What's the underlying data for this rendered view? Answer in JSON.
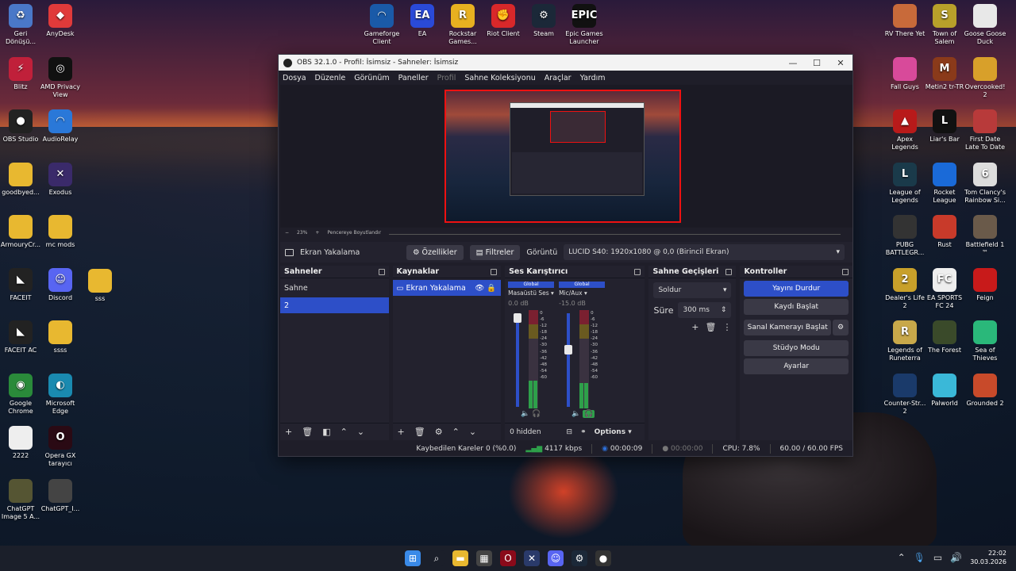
{
  "desktop": {
    "left_col1": [
      {
        "label": "Geri Dönüşü...",
        "icon": "recycle-bin-icon",
        "color": "#4a78c8",
        "glyph": "♻"
      },
      {
        "label": "Blitz",
        "icon": "blitz-icon",
        "color": "#c0203a",
        "glyph": "⚡"
      },
      {
        "label": "OBS Studio",
        "icon": "obs-icon",
        "color": "#222",
        "glyph": "●"
      },
      {
        "label": "goodbyed...",
        "icon": "folder-icon",
        "color": "#e8b830",
        "glyph": ""
      },
      {
        "label": "ArmouryCr...",
        "icon": "folder-icon",
        "color": "#e8b830",
        "glyph": ""
      },
      {
        "label": "FACEIT",
        "icon": "faceit-icon",
        "color": "#222",
        "glyph": "◣"
      },
      {
        "label": "FACEIT AC",
        "icon": "faceit-ac-icon",
        "color": "#222",
        "glyph": "◣"
      },
      {
        "label": "Google Chrome",
        "icon": "chrome-icon",
        "color": "#2a8a3a",
        "glyph": "◉"
      },
      {
        "label": "2222",
        "icon": "image-file-icon",
        "color": "#eee",
        "glyph": ""
      },
      {
        "label": "ChatGPT Image 5 A...",
        "icon": "image-file-icon",
        "color": "#553",
        "glyph": ""
      }
    ],
    "left_col2": [
      {
        "label": "AnyDesk",
        "icon": "anydesk-icon",
        "color": "#e03a3a",
        "glyph": "◆"
      },
      {
        "label": "AMD Privacy View",
        "icon": "amd-eye-icon",
        "color": "#111",
        "glyph": "◎"
      },
      {
        "label": "AudioRelay",
        "icon": "audiorelay-icon",
        "color": "#2a78d8",
        "glyph": "◠"
      },
      {
        "label": "Exodus",
        "icon": "exodus-icon",
        "color": "#3a2a6a",
        "glyph": "✕"
      },
      {
        "label": "mc mods",
        "icon": "folder-icon",
        "color": "#e8b830",
        "glyph": ""
      },
      {
        "label": "Discord",
        "icon": "discord-icon",
        "color": "#5865f2",
        "glyph": "☺"
      },
      {
        "label": "ssss",
        "icon": "folder-icon",
        "color": "#e8b830",
        "glyph": ""
      },
      {
        "label": "Microsoft Edge",
        "icon": "edge-icon",
        "color": "#1a8ab0",
        "glyph": "◐"
      },
      {
        "label": "Opera GX tarayıcı",
        "icon": "opera-gx-icon",
        "color": "#2a0a14",
        "glyph": "O"
      },
      {
        "label": "ChatGPT_I...",
        "icon": "image-file-icon",
        "color": "#444",
        "glyph": ""
      }
    ],
    "left_col3": [
      {
        "label": "sss",
        "icon": "folder-icon",
        "color": "#e8b830",
        "glyph": ""
      }
    ],
    "top_row": [
      {
        "label": "Gameforge Client",
        "icon": "gameforge-icon",
        "color": "#1a5aa8",
        "glyph": "◠"
      },
      {
        "label": "EA",
        "icon": "ea-icon",
        "color": "#2a4ad8",
        "glyph": "EA"
      },
      {
        "label": "Rockstar Games...",
        "icon": "rockstar-icon",
        "color": "#e8b020",
        "glyph": "R"
      },
      {
        "label": "Riot Client",
        "icon": "riot-icon",
        "color": "#d8282a",
        "glyph": "✊"
      },
      {
        "label": "Steam",
        "icon": "steam-icon",
        "color": "#1b2838",
        "glyph": "⚙"
      },
      {
        "label": "Epic Games Launcher",
        "icon": "epic-games-icon",
        "color": "#111",
        "glyph": "EPIC"
      }
    ],
    "right_col1": [
      {
        "label": "RV There Yet",
        "icon": "rv-there-yet-icon",
        "color": "#c86a3a",
        "glyph": ""
      },
      {
        "label": "Fall Guys",
        "icon": "fall-guys-icon",
        "color": "#d84a9a",
        "glyph": ""
      },
      {
        "label": "Apex Legends",
        "icon": "apex-icon",
        "color": "#b81a1a",
        "glyph": "▲"
      },
      {
        "label": "League of Legends",
        "icon": "lol-icon",
        "color": "#1a3a4a",
        "glyph": "L"
      },
      {
        "label": "PUBG BATTLEGR...",
        "icon": "pubg-icon",
        "color": "#333",
        "glyph": ""
      },
      {
        "label": "Dealer's Life 2",
        "icon": "dealers-life-icon",
        "color": "#c8a02a",
        "glyph": "2"
      },
      {
        "label": "Legends of Runeterra",
        "icon": "runeterra-icon",
        "color": "#c8a84a",
        "glyph": "R"
      },
      {
        "label": "Counter-Str... 2",
        "icon": "cs2-icon",
        "color": "#1a3a6a",
        "glyph": ""
      }
    ],
    "right_col2": [
      {
        "label": "Town of Salem",
        "icon": "town-of-salem-icon",
        "color": "#b8a02a",
        "glyph": "S"
      },
      {
        "label": "Metin2 tr-TR",
        "icon": "metin2-icon",
        "color": "#8a3a1a",
        "glyph": "M"
      },
      {
        "label": "Liar's Bar",
        "icon": "liars-bar-icon",
        "color": "#111",
        "glyph": "L"
      },
      {
        "label": "Rocket League",
        "icon": "rocket-league-icon",
        "color": "#1a6ad8",
        "glyph": ""
      },
      {
        "label": "Rust",
        "icon": "rust-icon",
        "color": "#c83a2a",
        "glyph": ""
      },
      {
        "label": "EA SPORTS FC 24",
        "icon": "fc24-icon",
        "color": "#eee",
        "glyph": "FC"
      },
      {
        "label": "The Forest",
        "icon": "the-forest-icon",
        "color": "#3a4a2a",
        "glyph": ""
      },
      {
        "label": "Palworld",
        "icon": "palworld-icon",
        "color": "#3ab8d8",
        "glyph": ""
      }
    ],
    "right_col3": [
      {
        "label": "Goose Goose Duck",
        "icon": "goose-goose-duck-icon",
        "color": "#e8e8e8",
        "glyph": ""
      },
      {
        "label": "Overcooked! 2",
        "icon": "overcooked-icon",
        "color": "#d8a02a",
        "glyph": ""
      },
      {
        "label": "First Date Late To Date",
        "icon": "first-date-icon",
        "color": "#b83a3a",
        "glyph": ""
      },
      {
        "label": "Tom Clancy's Rainbow Si...",
        "icon": "rainbow-six-icon",
        "color": "#ddd",
        "glyph": "6"
      },
      {
        "label": "Battlefield 1 ™",
        "icon": "battlefield-icon",
        "color": "#6a5a4a",
        "glyph": ""
      },
      {
        "label": "Feign",
        "icon": "feign-icon",
        "color": "#c81a1a",
        "glyph": ""
      },
      {
        "label": "Sea of Thieves",
        "icon": "sea-of-thieves-icon",
        "color": "#2ab87a",
        "glyph": ""
      },
      {
        "label": "Grounded 2",
        "icon": "grounded-icon",
        "color": "#c84a2a",
        "glyph": ""
      }
    ]
  },
  "obs": {
    "title": "OBS 32.1.0 - Profil: İsimsiz - Sahneler: İsimsiz",
    "menu": [
      "Dosya",
      "Düzenle",
      "Görünüm",
      "Paneller",
      "Profil",
      "Sahne Koleksiyonu",
      "Araçlar",
      "Yardım"
    ],
    "zoom": {
      "minus": "−",
      "value": "23%",
      "plus": "+",
      "fit": "Pencereye Boyutlandır"
    },
    "source_bar": {
      "source_name": "Ekran Yakalama",
      "properties": "Özellikler",
      "filters": "Filtreler",
      "display_label": "Görüntü",
      "display_value": "LUCID S40: 1920x1080 @ 0,0 (Birincil Ekran)"
    },
    "scenes": {
      "title": "Sahneler",
      "items": [
        "Sahne",
        "2"
      ],
      "selected": 1
    },
    "sources": {
      "title": "Kaynaklar",
      "items": [
        "Ekran Yakalama"
      ]
    },
    "mixer": {
      "title": "Ses Karıştırıcı",
      "channels": [
        {
          "scope": "Global",
          "name": "Masaüstü Ses",
          "db": "0.0 dB",
          "level": 0.28,
          "fader": 1.0
        },
        {
          "scope": "Global",
          "name": "Mic/Aux",
          "db": "-15.0 dB",
          "level": 0.26,
          "fader": 0.62
        }
      ],
      "scale": [
        "0",
        "-6",
        "-12",
        "-18",
        "-24",
        "-30",
        "-36",
        "-42",
        "-48",
        "-54",
        "-60"
      ],
      "hidden": "0 hidden",
      "options": "Options"
    },
    "transitions": {
      "title": "Sahne Geçişleri",
      "type": "Soldur",
      "duration_label": "Süre",
      "duration": "300 ms"
    },
    "controls": {
      "title": "Kontroller",
      "stop_stream": "Yayını Durdur",
      "start_record": "Kaydı Başlat",
      "virtual_cam": "Sanal Kamerayı Başlat",
      "studio": "Stüdyo Modu",
      "settings": "Ayarlar"
    },
    "status": {
      "dropped": "Kaybedilen Kareler 0 (%0.0)",
      "bitrate": "4117 kbps",
      "stream_time": "00:00:09",
      "record_time": "00:00:00",
      "cpu": "CPU: 7.8%",
      "fps": "60.00 / 60.00 FPS"
    }
  },
  "taskbar": {
    "apps": [
      {
        "icon": "windows-start-icon",
        "glyph": "⊞",
        "color": "#3a8ae8"
      },
      {
        "icon": "search-icon",
        "glyph": "⌕",
        "color": "#1b1f2a"
      },
      {
        "icon": "file-explorer-icon",
        "glyph": "▬",
        "color": "#e8b830"
      },
      {
        "icon": "calculator-icon",
        "glyph": "▦",
        "color": "#444"
      },
      {
        "icon": "opera-gx-icon",
        "glyph": "O",
        "color": "#8a0a1a"
      },
      {
        "icon": "exodus-app-icon",
        "glyph": "✕",
        "color": "#2a3a6a"
      },
      {
        "icon": "discord-app-icon",
        "glyph": "☺",
        "color": "#5865f2"
      },
      {
        "icon": "steam-app-icon",
        "glyph": "⚙",
        "color": "#1b2838"
      },
      {
        "icon": "obs-app-icon",
        "glyph": "●",
        "color": "#333"
      }
    ],
    "time": "22:02",
    "date": "30.03.2026"
  }
}
